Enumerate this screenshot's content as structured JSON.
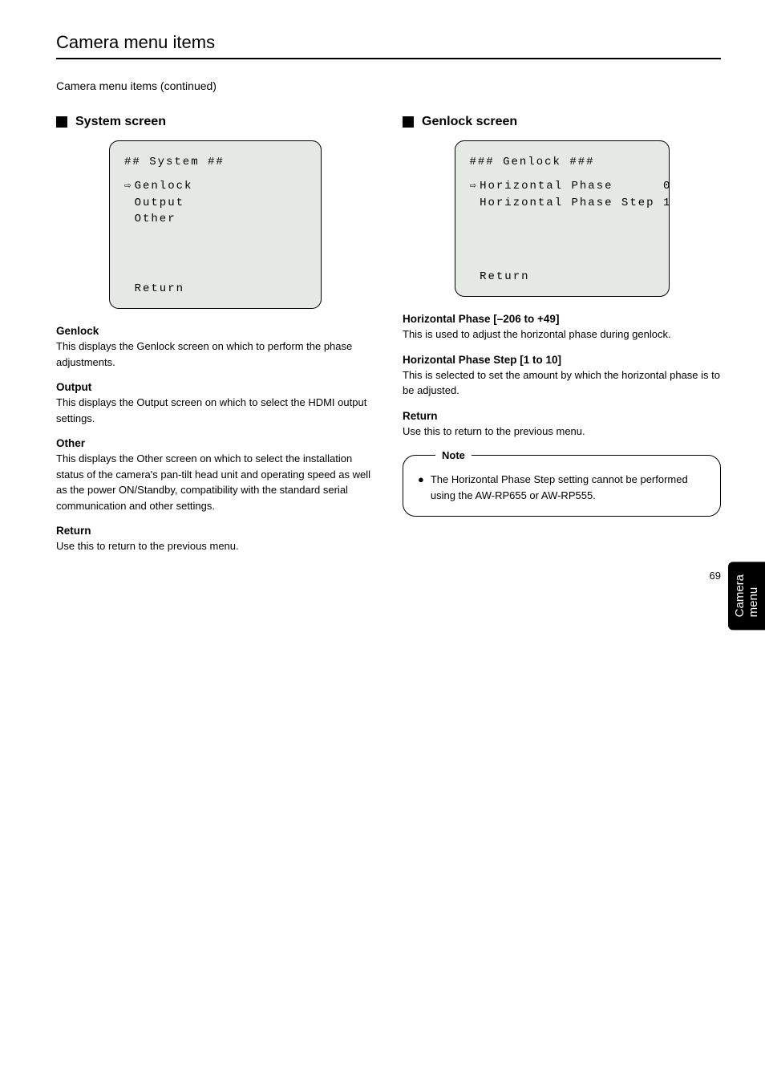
{
  "header": {
    "title": "Camera menu items",
    "subtitle": "Camera menu items (continued)"
  },
  "left": {
    "section_title": "System screen",
    "screen": {
      "title": "## System ##",
      "items": [
        "Genlock",
        "Output",
        "Other"
      ],
      "selected_index": 0,
      "return": "Return"
    },
    "items": [
      {
        "head": "Genlock",
        "body": "This displays the Genlock screen on which to perform the phase adjustments."
      },
      {
        "head": "Output",
        "body": "This displays the Output screen on which to select the HDMI output settings."
      },
      {
        "head": "Other",
        "body": "This displays the Other screen on which to select the installation status of the camera's pan-tilt head unit and operating speed as well as the power ON/Standby, compatibility with the standard serial communication and other settings."
      },
      {
        "head": "Return",
        "body": "Use this to return to the previous menu."
      }
    ]
  },
  "right": {
    "section_title": "Genlock screen",
    "screen": {
      "title": "### Genlock ###",
      "rows": [
        {
          "label": "Horizontal Phase",
          "value": "0",
          "selected": true
        },
        {
          "label": "Horizontal Phase Step",
          "value": "1",
          "selected": false
        }
      ],
      "return": "Return"
    },
    "items": [
      {
        "head": "Horizontal Phase [–206 to +49]",
        "range": "",
        "body": "This is used to adjust the horizontal phase during genlock."
      },
      {
        "head": "Horizontal Phase Step [1 to 10]",
        "range": "",
        "body": "This is selected to set the amount by which the horizontal phase is to be adjusted."
      },
      {
        "head": "Return",
        "range": "",
        "body": "Use this to return to the previous menu."
      }
    ],
    "note": {
      "label": "Note",
      "text": "The Horizontal Phase Step setting cannot be performed using the AW-RP655 or AW-RP555."
    }
  },
  "side_tab": "Camera menu",
  "page_number": "69"
}
